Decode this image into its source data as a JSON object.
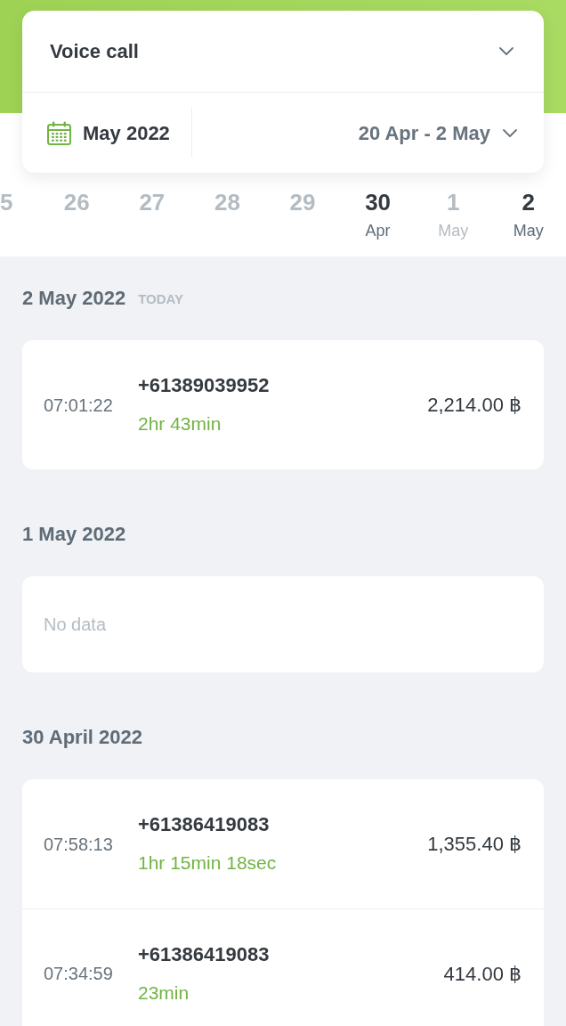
{
  "filter_card": {
    "call_type": "Voice call",
    "month": "May 2022",
    "range": "20 Apr - 2 May"
  },
  "day_strip": [
    {
      "day": "5",
      "has_data": false
    },
    {
      "day": "26",
      "has_data": false
    },
    {
      "day": "27",
      "has_data": false
    },
    {
      "day": "28",
      "has_data": false
    },
    {
      "day": "29",
      "has_data": false
    },
    {
      "day": "30",
      "month": "Apr",
      "has_data": true
    },
    {
      "day": "1",
      "month": "May",
      "has_data": false
    },
    {
      "day": "2",
      "month": "May",
      "has_data": true
    }
  ],
  "sections": [
    {
      "date": "2 May 2022",
      "tag": "TODAY",
      "calls": [
        {
          "time": "07:01:22",
          "number": "+61389039952",
          "duration": "2hr 43min",
          "amount": "2,214.00 ฿"
        }
      ]
    },
    {
      "date": "1 May 2022",
      "empty_text": "No data"
    },
    {
      "date": "30 April 2022",
      "calls": [
        {
          "time": "07:58:13",
          "number": "+61386419083",
          "duration": "1hr 15min 18sec",
          "amount": "1,355.40 ฿"
        },
        {
          "time": "07:34:59",
          "number": "+61386419083",
          "duration": "23min",
          "amount": "414.00 ฿"
        }
      ]
    }
  ]
}
